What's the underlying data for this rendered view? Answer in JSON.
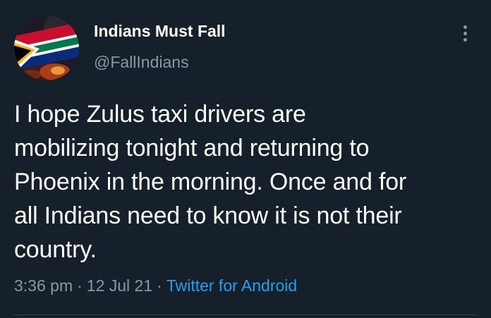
{
  "tweet": {
    "author": {
      "display_name": "Indians Must Fall",
      "handle": "@FallIndians",
      "avatar_icon": "south-africa-flag-avatar"
    },
    "menu_icon": "more-vertical-icon",
    "text": "I hope Zulus taxi drivers are\nmobilizing tonight and returning to\nPhoenix in the morning. Once and for\nall Indians need to know it is not their\ncountry.",
    "time": "3:36 pm",
    "separator": "·",
    "date": "12 Jul 21",
    "source": "Twitter for Android"
  },
  "colors": {
    "background": "#15202b",
    "primary_text": "#ffffff",
    "secondary_text": "#8899a6",
    "link": "#1da1f2",
    "divider": "#38444d"
  }
}
